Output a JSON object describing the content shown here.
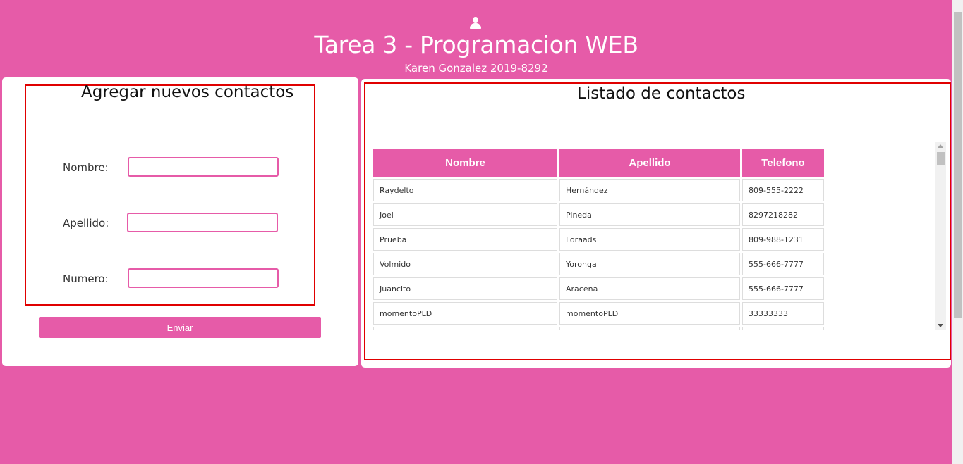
{
  "header": {
    "icon": "user-icon",
    "title": "Tarea 3 - Programacion WEB",
    "subtitle": "Karen Gonzalez 2019-8292"
  },
  "form": {
    "title": "Agregar nuevos contactos",
    "fields": {
      "nombre_label": "Nombre:",
      "apellido_label": "Apellido:",
      "numero_label": "Numero:"
    },
    "submit_label": "Enviar"
  },
  "list": {
    "title": "Listado de contactos",
    "columns": [
      "Nombre",
      "Apellido",
      "Telefono"
    ],
    "rows": [
      [
        "Raydelto",
        "Hernández",
        "809-555-2222"
      ],
      [
        "Joel",
        "Pineda",
        "8297218282"
      ],
      [
        "Prueba",
        "Loraads",
        "809-988-1231"
      ],
      [
        "Volmido",
        "Yoronga",
        "555-666-7777"
      ],
      [
        "Juancito",
        "Aracena",
        "555-666-7777"
      ],
      [
        "momentoPLD",
        "momentoPLD",
        "33333333"
      ],
      [
        "",
        "",
        ""
      ]
    ]
  },
  "colors": {
    "accent": "#e65ba8",
    "highlight": "#e00000"
  }
}
